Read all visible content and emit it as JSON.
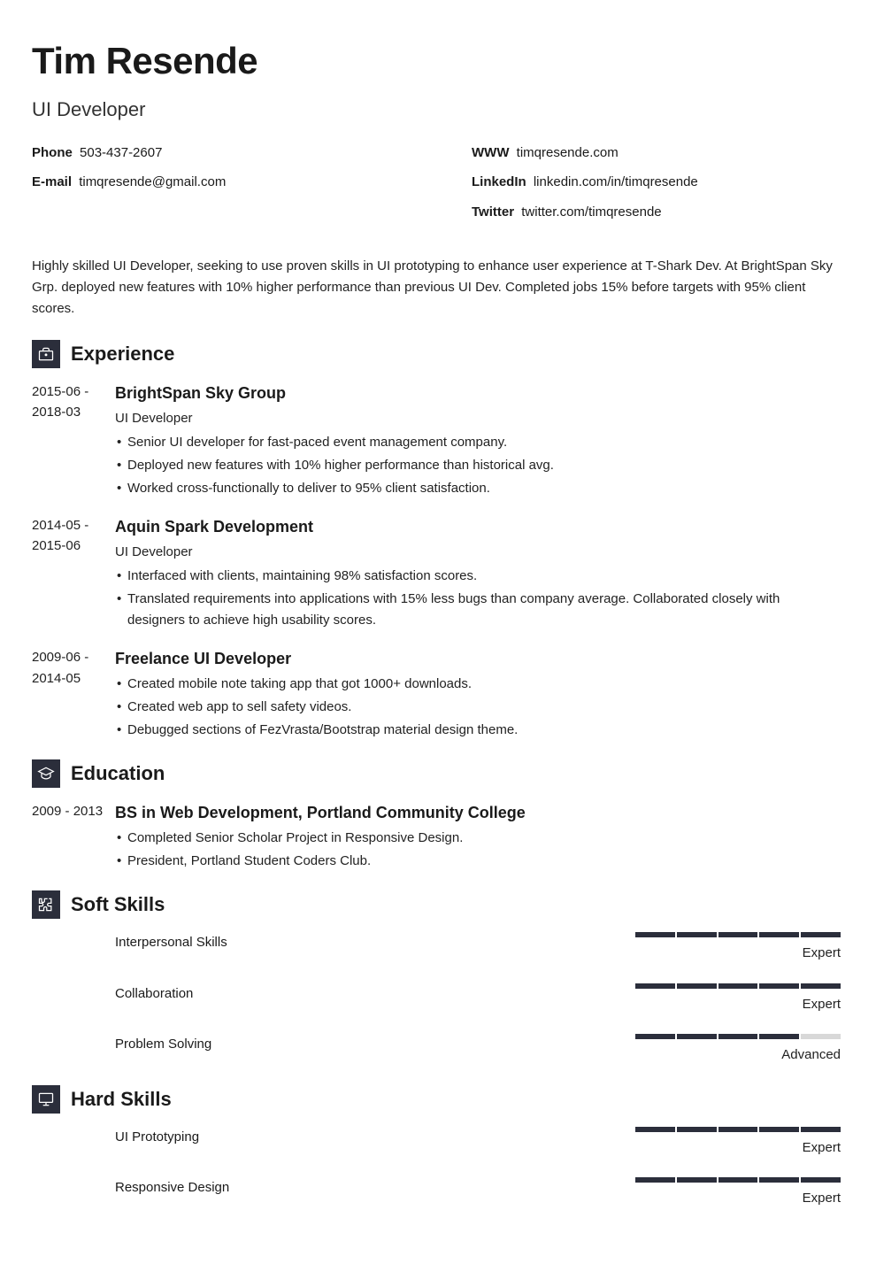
{
  "header": {
    "name": "Tim Resende",
    "title": "UI Developer"
  },
  "contacts": {
    "left": [
      {
        "label": "Phone",
        "value": "503-437-2607"
      },
      {
        "label": "E-mail",
        "value": "timqresende@gmail.com"
      }
    ],
    "right": [
      {
        "label": "WWW",
        "value": "timqresende.com"
      },
      {
        "label": "LinkedIn",
        "value": "linkedin.com/in/timqresende"
      },
      {
        "label": "Twitter",
        "value": "twitter.com/timqresende"
      }
    ]
  },
  "summary": "Highly skilled UI Developer, seeking to use proven skills in UI prototyping to enhance user experience at T-Shark Dev. At BrightSpan Sky Grp. deployed new features with 10% higher performance than previous UI Dev. Completed jobs 15% before targets with 95% client scores.",
  "sections": {
    "experience": {
      "title": "Experience",
      "items": [
        {
          "dates": "2015-06 - 2018-03",
          "title": "BrightSpan Sky Group",
          "role": "UI Developer",
          "bullets": [
            "Senior UI developer for fast-paced event management company.",
            "Deployed new features with 10% higher performance than historical avg.",
            "Worked cross-functionally to deliver to 95% client satisfaction."
          ]
        },
        {
          "dates": "2014-05 - 2015-06",
          "title": "Aquin Spark Development",
          "role": "UI Developer",
          "bullets": [
            "Interfaced with clients, maintaining 98% satisfaction scores.",
            "Translated requirements into applications with 15% less bugs than company average. Collaborated closely with designers to achieve high usability scores."
          ]
        },
        {
          "dates": "2009-06 - 2014-05",
          "title": "Freelance UI Developer",
          "role": "",
          "bullets": [
            "Created mobile note taking app that got 1000+ downloads.",
            "Created web app to sell safety videos.",
            "Debugged sections of FezVrasta/Bootstrap material design theme."
          ]
        }
      ]
    },
    "education": {
      "title": "Education",
      "items": [
        {
          "dates": "2009 - 2013",
          "title": "BS in Web Development, Portland Community College",
          "role": "",
          "bullets": [
            "Completed Senior Scholar Project in Responsive Design.",
            "President, Portland Student Coders Club."
          ]
        }
      ]
    },
    "softskills": {
      "title": "Soft Skills",
      "items": [
        {
          "name": "Interpersonal Skills",
          "level": "Expert",
          "filled": 5
        },
        {
          "name": "Collaboration",
          "level": "Expert",
          "filled": 5
        },
        {
          "name": "Problem Solving",
          "level": "Advanced",
          "filled": 4
        }
      ]
    },
    "hardskills": {
      "title": "Hard Skills",
      "items": [
        {
          "name": "UI Prototyping",
          "level": "Expert",
          "filled": 5
        },
        {
          "name": "Responsive Design",
          "level": "Expert",
          "filled": 5
        }
      ]
    }
  }
}
